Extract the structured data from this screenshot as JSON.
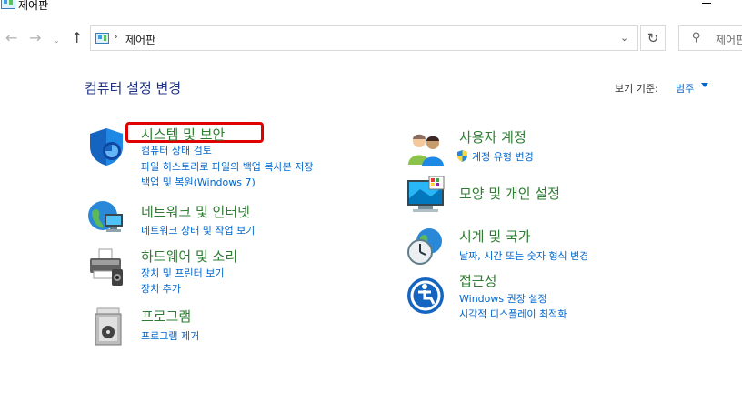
{
  "window": {
    "title": "제어판"
  },
  "address": {
    "path": "제어판",
    "separator": "›"
  },
  "search": {
    "placeholder": "제어판"
  },
  "nav": {
    "back": "←",
    "forward": "→",
    "recent": "⌄",
    "up": "↑",
    "refresh": "↻",
    "dropdown": "⌄"
  },
  "header": {
    "title": "컴퓨터 설정 변경",
    "view_by_label": "보기 기준:",
    "view_by_value": "범주"
  },
  "categories": [
    {
      "icon": "shield-icon",
      "title": "시스템 및 보안",
      "links": [
        "컴퓨터 상태 검토",
        "파일 히스토리로 파일의 백업 복사본 저장",
        "백업 및 복원(Windows 7)"
      ]
    },
    {
      "icon": "network-globe-icon",
      "title": "네트워크 및 인터넷",
      "links": [
        "네트워크 상태 및 작업 보기"
      ]
    },
    {
      "icon": "printer-icon",
      "title": "하드웨어 및 소리",
      "links": [
        "장치 및 프린터 보기",
        "장치 추가"
      ]
    },
    {
      "icon": "programs-icon",
      "title": "프로그램",
      "links": [
        "프로그램 제거"
      ]
    },
    {
      "icon": "users-icon",
      "title": "사용자 계정",
      "links": [
        "계정 유형 변경"
      ]
    },
    {
      "icon": "display-palette-icon",
      "title": "모양 및 개인 설정",
      "links": []
    },
    {
      "icon": "clock-globe-icon",
      "title": "시계 및 국가",
      "links": [
        "날짜, 시간 또는 숫자 형식 변경"
      ]
    },
    {
      "icon": "accessibility-icon",
      "title": "접근성",
      "links": [
        "Windows 권장 설정",
        "시각적 디스플레이 최적화"
      ]
    }
  ],
  "colors": {
    "category_title": "#2e7d32",
    "link": "#0066cc",
    "header_title": "#1e3287",
    "highlight": "#e00000"
  }
}
